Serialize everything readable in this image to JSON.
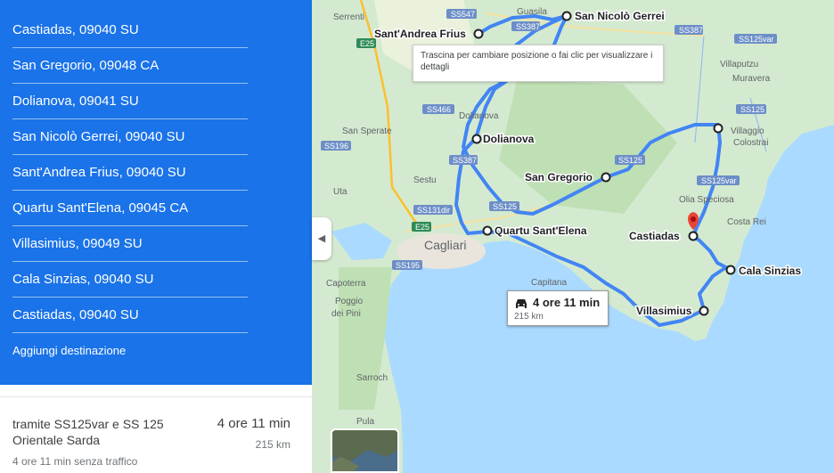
{
  "stops": [
    {
      "label": "Castiadas, 09040 SU"
    },
    {
      "label": "San Gregorio, 09048 CA"
    },
    {
      "label": "Dolianova, 09041 SU"
    },
    {
      "label": "San Nicolò Gerrei, 09040 SU"
    },
    {
      "label": "Sant'Andrea Frius, 09040 SU"
    },
    {
      "label": "Quartu Sant'Elena, 09045 CA"
    },
    {
      "label": "Villasimius, 09049 SU"
    },
    {
      "label": "Cala Sinzias, 09040 SU"
    },
    {
      "label": "Castiadas, 09040 SU"
    }
  ],
  "add_destination": "Aggiungi destinazione",
  "route": {
    "via": "tramite SS125var e SS 125 Orientale Sarda",
    "time": "4 ore 11 min",
    "distance": "215 km",
    "traffic": "4 ore 11 min senza traffico"
  },
  "tooltip": "Trascina per cambiare posizione o fai clic per visualizzare i dettagli",
  "duration_box": {
    "time": "4 ore 11 min",
    "distance": "215 km"
  },
  "map_labels": {
    "san_nicolo": "San Nicolò Gerrei",
    "sant_andrea": "Sant'Andrea Frius",
    "dolianova_stop": "Dolianova",
    "san_gregorio": "San Gregorio",
    "quartu": "Quartu Sant'Elena",
    "castiadas": "Castiadas",
    "cala_sinzias": "Cala Sinzias",
    "villasimius": "Villasimius",
    "serrenti": "Serrenti",
    "guasila": "Guasila",
    "villaputzu": "Villaputzu",
    "muravera": "Muravera",
    "villaggio_colostrai_1": "Villaggio",
    "villaggio_colostrai_2": "Colostrai",
    "olia_speciosa": "Olia Speciosa",
    "costa_rei": "Costa Rei",
    "san_sperate": "San Sperate",
    "sestu": "Sestu",
    "uta": "Uta",
    "cagliari": "Cagliari",
    "capitana": "Capitana",
    "capoterra": "Capoterra",
    "poggio_1": "Poggio",
    "poggio_2": "dei Pini",
    "sarroch": "Sarroch",
    "pula": "Pula",
    "dolianova_town": "Dolianova",
    "ss547": "SS547",
    "ss387a": "SS387",
    "ss387b": "SS387",
    "ss387c": "SS387",
    "e25a": "E25",
    "e25b": "E25",
    "ss466": "SS466",
    "ss196": "SS196",
    "ss125a": "SS125",
    "ss125b": "SS125",
    "ss125c": "SS125",
    "ss125var_a": "SS125var",
    "ss125var_b": "SS125var",
    "ss131dir": "SS131dir",
    "ss195": "SS195"
  },
  "colors": {
    "panel_blue": "#1a73e8",
    "route": "#4285f4",
    "land": "#cfe8c6",
    "sea": "#aadaff",
    "pin": "#ea4335"
  }
}
